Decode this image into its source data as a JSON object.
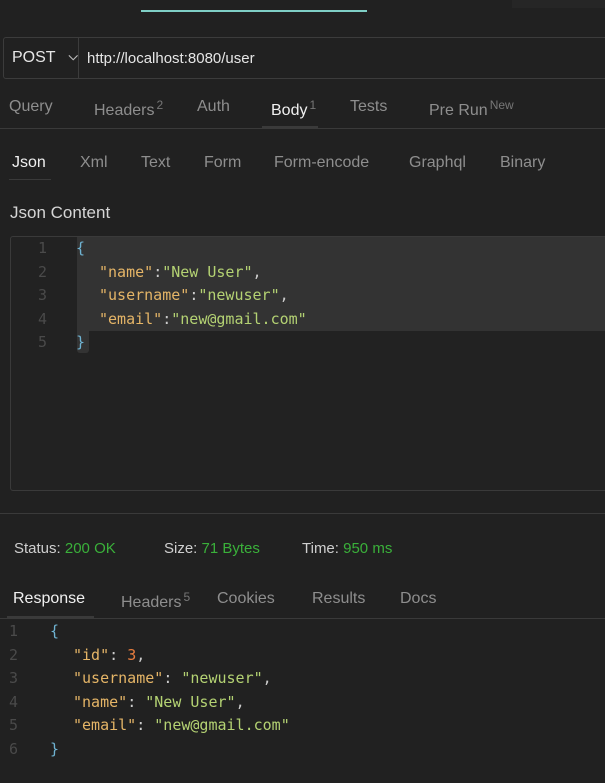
{
  "request": {
    "method": "POST",
    "url": "http://localhost:8080/user"
  },
  "tabs": [
    {
      "label": "Query"
    },
    {
      "label": "Headers",
      "badge": "2"
    },
    {
      "label": "Auth"
    },
    {
      "label": "Body",
      "badge": "1",
      "active": true
    },
    {
      "label": "Tests"
    },
    {
      "label": "Pre Run",
      "badge": "New"
    }
  ],
  "body_tabs": [
    {
      "label": "Json",
      "active": true
    },
    {
      "label": "Xml"
    },
    {
      "label": "Text"
    },
    {
      "label": "Form"
    },
    {
      "label": "Form-encode"
    },
    {
      "label": "Graphql"
    },
    {
      "label": "Binary"
    }
  ],
  "json_content_label": "Json Content",
  "request_body": [
    {
      "n": "1",
      "t": "{"
    },
    {
      "n": "2",
      "k": "\"name\"",
      "sep": ":",
      "v": "\"New User\"",
      "e": ","
    },
    {
      "n": "3",
      "k": "\"username\"",
      "sep": ":",
      "v": "\"newuser\"",
      "e": ","
    },
    {
      "n": "4",
      "k": "\"email\"",
      "sep": ":",
      "v": "\"new@gmail.com\"",
      "e": ""
    },
    {
      "n": "5",
      "t": "}"
    }
  ],
  "status": {
    "status_label": "Status:",
    "status_value": "200 OK",
    "size_label": "Size:",
    "size_value": "71 Bytes",
    "time_label": "Time:",
    "time_value": "950 ms",
    "color": "#3ab03a"
  },
  "response_tabs": [
    {
      "label": "Response",
      "active": true
    },
    {
      "label": "Headers",
      "badge": "5"
    },
    {
      "label": "Cookies"
    },
    {
      "label": "Results"
    },
    {
      "label": "Docs"
    }
  ],
  "response_body": [
    {
      "n": "1",
      "t": "{"
    },
    {
      "n": "2",
      "k": "\"id\"",
      "sep": ": ",
      "v": "3",
      "e": ",",
      "num": true
    },
    {
      "n": "3",
      "k": "\"username\"",
      "sep": ": ",
      "v": "\"newuser\"",
      "e": ","
    },
    {
      "n": "4",
      "k": "\"name\"",
      "sep": ": ",
      "v": "\"New User\"",
      "e": ","
    },
    {
      "n": "5",
      "k": "\"email\"",
      "sep": ": ",
      "v": "\"new@gmail.com\"",
      "e": ""
    },
    {
      "n": "6",
      "t": "}"
    }
  ]
}
